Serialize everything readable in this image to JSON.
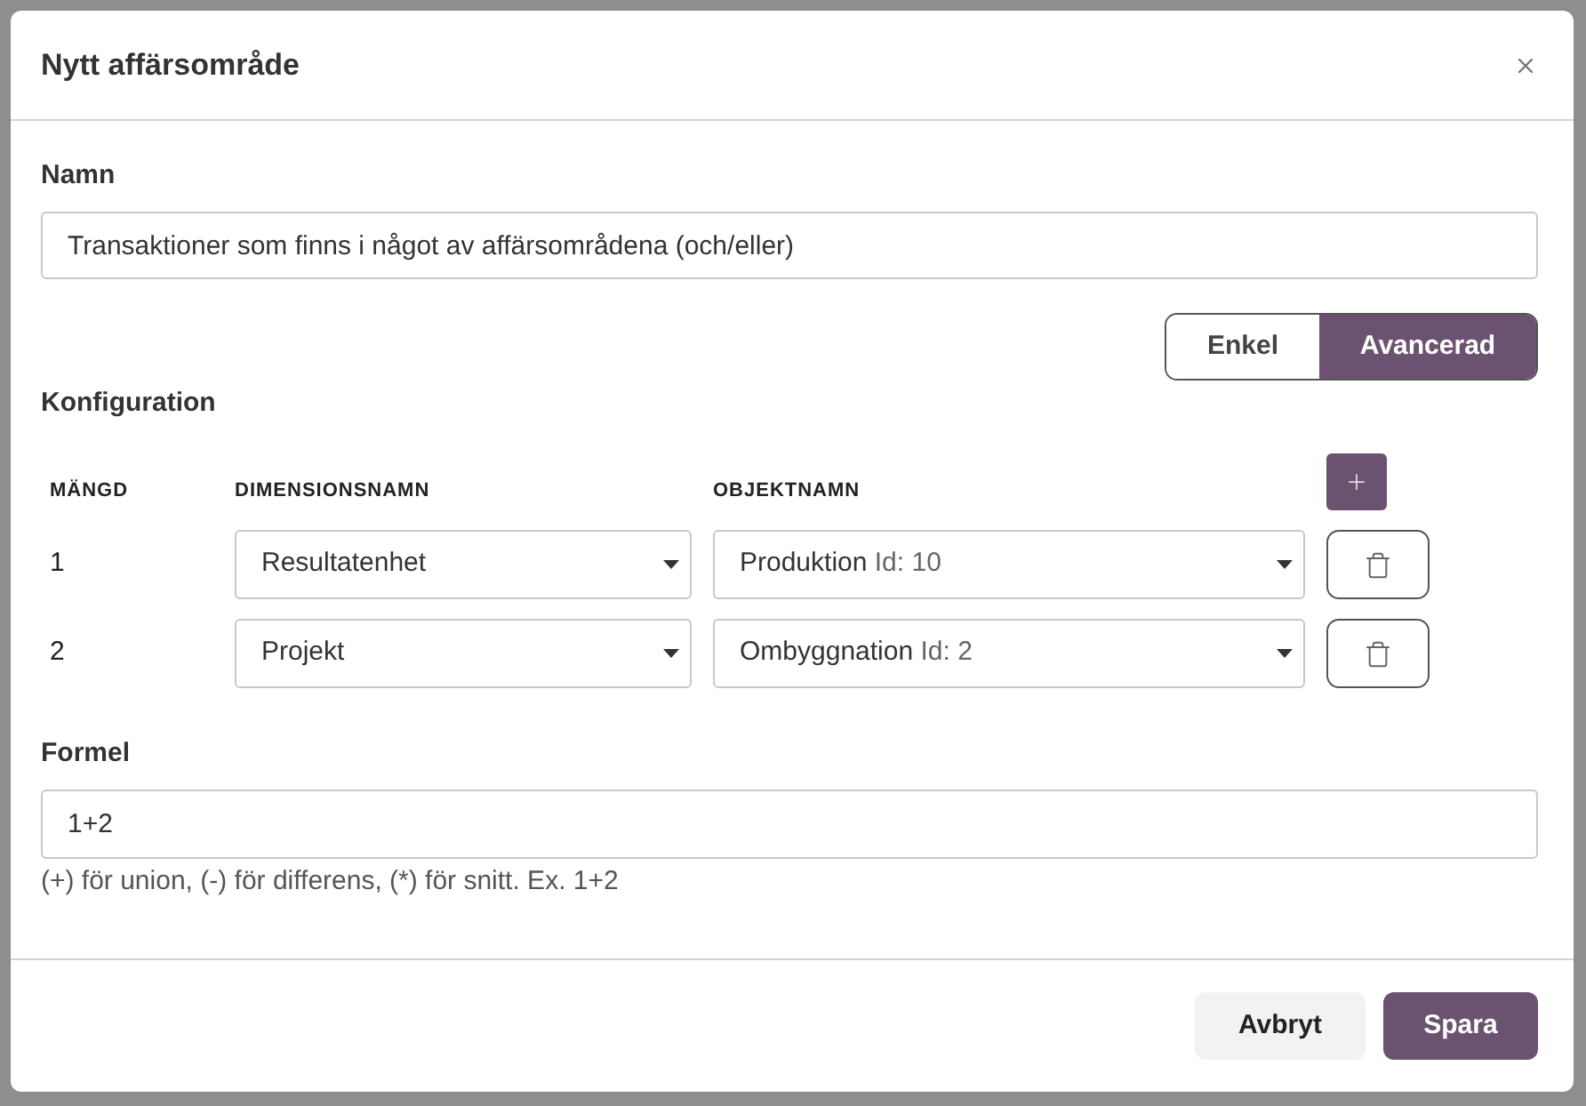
{
  "dialog": {
    "title": "Nytt affärsområde"
  },
  "name_field": {
    "label": "Namn",
    "value": "Transaktioner som finns i något av affärsområdena (och/eller)"
  },
  "mode_toggle": [
    {
      "label": "Enkel",
      "selected": false
    },
    {
      "label": "Avancerad",
      "selected": true
    }
  ],
  "configuration": {
    "title": "Konfiguration",
    "columns": [
      "MÄNGD",
      "DIMENSIONSNAMN",
      "OBJEKTNAMN"
    ],
    "rows": [
      {
        "set": "1",
        "dimension": "Resultatenhet",
        "object": "Produktion",
        "object_id": "Id: 10"
      },
      {
        "set": "2",
        "dimension": "Projekt",
        "object": "Ombyggnation",
        "object_id": "Id: 2"
      }
    ]
  },
  "formula_field": {
    "label": "Formel",
    "value": "1+2",
    "hint": "(+) för union, (-) för differens, (*) för snitt. Ex. 1+2"
  },
  "buttons": [
    {
      "label": "Avbryt",
      "kind": "secondary"
    },
    {
      "label": "Spara",
      "kind": "primary"
    }
  ]
}
